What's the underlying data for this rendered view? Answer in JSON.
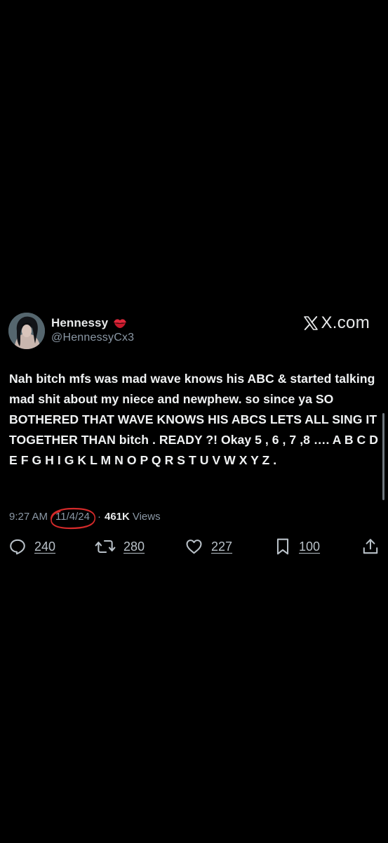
{
  "author": {
    "display_name": "Hennessy",
    "handle": "@HennessyCx3",
    "name_emoji_icon": "kiss-mark-icon",
    "avatar_icon": "profile-photo"
  },
  "brand": {
    "text": "X.com",
    "icon": "x-logo-icon"
  },
  "tweet": {
    "text": "Nah bitch mfs was mad wave knows his ABC & started talking mad shit about my niece and newphew. so since ya SO BOTHERED THAT WAVE KNOWS HIS ABCS LETS ALL SING IT TOGETHER THAN bitch . READY ?! Okay 5 , 6 , 7 ,8 …. A B C D E F G H I G K L M N O P Q R S T U V W X Y Z ."
  },
  "meta": {
    "time": "9:27 AM",
    "separator": "·",
    "date": "11/4/24",
    "views_count": "461K",
    "views_label": "Views",
    "date_annotation_color": "#d42a2a"
  },
  "actions": {
    "reply": {
      "icon": "reply-icon",
      "count": "240"
    },
    "retweet": {
      "icon": "retweet-icon",
      "count": "280"
    },
    "like": {
      "icon": "heart-icon",
      "count": "227"
    },
    "bookmark": {
      "icon": "bookmark-icon",
      "count": "100"
    },
    "share": {
      "icon": "share-icon"
    }
  },
  "colors": {
    "background": "#000000",
    "primary_text": "#e7e9ea",
    "secondary_text": "#8b98a5",
    "annotation": "#d42a2a"
  }
}
